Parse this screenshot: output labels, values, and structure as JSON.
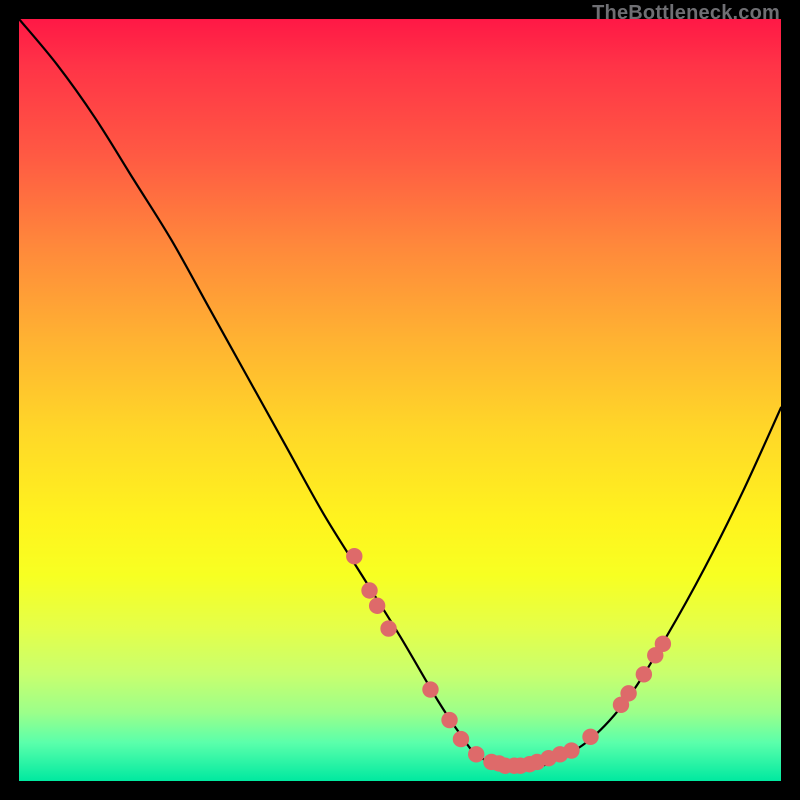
{
  "watermark": "TheBottleneck.com",
  "chart_data": {
    "type": "line",
    "title": "",
    "xlabel": "",
    "ylabel": "",
    "xlim": [
      0,
      100
    ],
    "ylim": [
      0,
      100
    ],
    "series": [
      {
        "name": "curve",
        "x": [
          0,
          5,
          10,
          15,
          20,
          25,
          30,
          35,
          40,
          45,
          50,
          55,
          58,
          60,
          63,
          66,
          70,
          75,
          80,
          85,
          90,
          95,
          100
        ],
        "y": [
          100,
          94,
          87,
          79,
          71,
          62,
          53,
          44,
          35,
          27,
          19,
          10.5,
          6,
          3.5,
          2,
          1.5,
          2.5,
          5.5,
          11,
          19,
          28,
          38,
          49
        ]
      }
    ],
    "markers": [
      {
        "x": 44.0,
        "y": 29.5
      },
      {
        "x": 46.0,
        "y": 25.0
      },
      {
        "x": 47.0,
        "y": 23.0
      },
      {
        "x": 48.5,
        "y": 20.0
      },
      {
        "x": 54.0,
        "y": 12.0
      },
      {
        "x": 56.5,
        "y": 8.0
      },
      {
        "x": 58.0,
        "y": 5.5
      },
      {
        "x": 60.0,
        "y": 3.5
      },
      {
        "x": 62.0,
        "y": 2.5
      },
      {
        "x": 63.0,
        "y": 2.3
      },
      {
        "x": 63.8,
        "y": 2.0
      },
      {
        "x": 65.0,
        "y": 2.0
      },
      {
        "x": 65.8,
        "y": 2.0
      },
      {
        "x": 67.0,
        "y": 2.2
      },
      {
        "x": 68.0,
        "y": 2.5
      },
      {
        "x": 69.5,
        "y": 3.0
      },
      {
        "x": 71.0,
        "y": 3.5
      },
      {
        "x": 72.5,
        "y": 4.0
      },
      {
        "x": 75.0,
        "y": 5.8
      },
      {
        "x": 79.0,
        "y": 10.0
      },
      {
        "x": 80.0,
        "y": 11.5
      },
      {
        "x": 82.0,
        "y": 14.0
      },
      {
        "x": 83.5,
        "y": 16.5
      },
      {
        "x": 84.5,
        "y": 18.0
      }
    ],
    "colors": {
      "curve_stroke": "#000000",
      "marker_fill": "#de6a6a"
    }
  }
}
